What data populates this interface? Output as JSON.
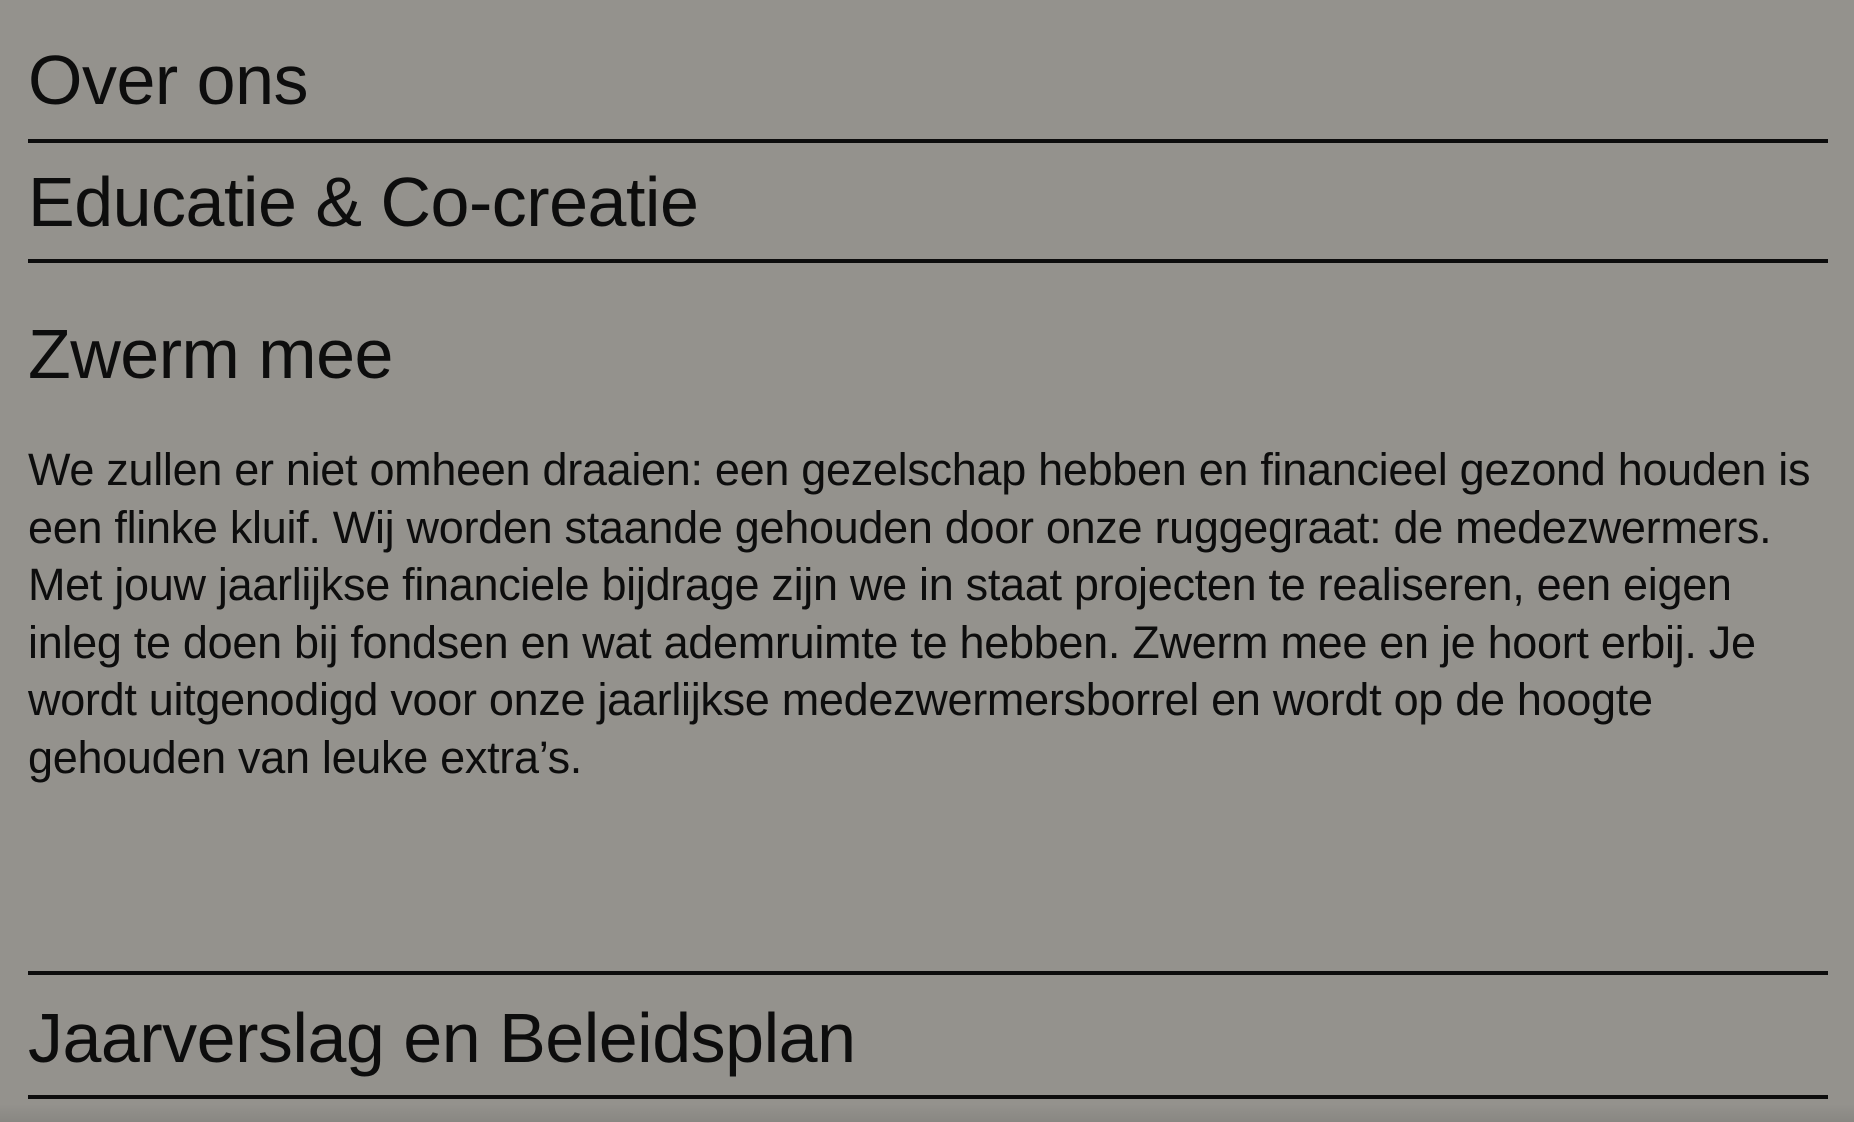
{
  "colors": {
    "background": "#94928d",
    "text": "#0d0d0d",
    "divider": "#0d0d0d"
  },
  "sections": [
    {
      "title": "Over ons",
      "expanded": false
    },
    {
      "title": "Educatie & Co-creatie",
      "expanded": false
    },
    {
      "title": "Zwerm mee",
      "expanded": true,
      "body": "We zullen er niet omheen draaien: een gezelschap hebben en financieel gezond houden is een flinke kluif. Wij worden staande gehouden door onze ruggegraat: de medezwermers. Met jouw jaarlijkse financiele bijdrage zijn we in staat projecten te realiseren, een eigen inleg te doen bij fondsen en wat ademruimte te hebben. Zwerm mee en je hoort erbij. Je wordt uitgenodigd voor onze jaarlijkse medezwermersborrel en wordt op de hoogte gehouden van leuke extra’s."
    },
    {
      "title": "Jaarverslag en Beleidsplan",
      "expanded": false
    }
  ]
}
